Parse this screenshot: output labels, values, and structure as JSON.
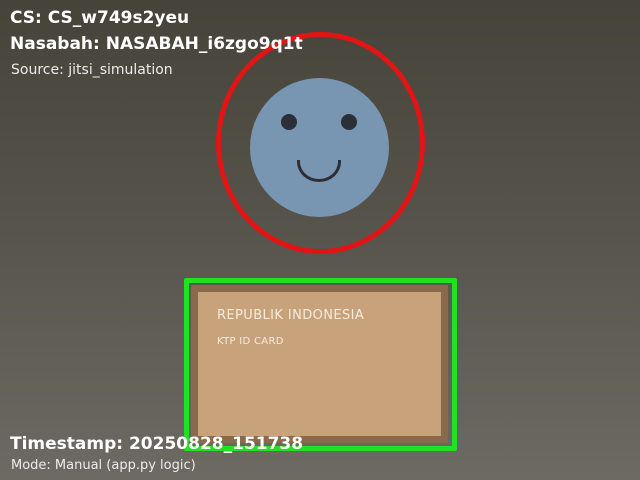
{
  "overlay": {
    "cs_label": "CS: CS_w749s2yeu",
    "nasabah_label": "Nasabah: NASABAH_i6zgo9q1t",
    "source_label": "Source: jitsi_simulation",
    "timestamp_label": "Timestamp: 20250828_151738",
    "mode_label": "Mode: Manual (app.py logic)"
  },
  "id_card": {
    "title": "REPUBLIK INDONESIA",
    "subtitle": "KTP ID CARD"
  },
  "colors": {
    "face_fill": "#7895b2",
    "face_features": "#2c2f35",
    "face_box": "#e31414",
    "card_border": "#8a6a4c",
    "card_fill": "#c8a27a",
    "card_text": "#f5ecde",
    "card_box": "#22e022"
  }
}
